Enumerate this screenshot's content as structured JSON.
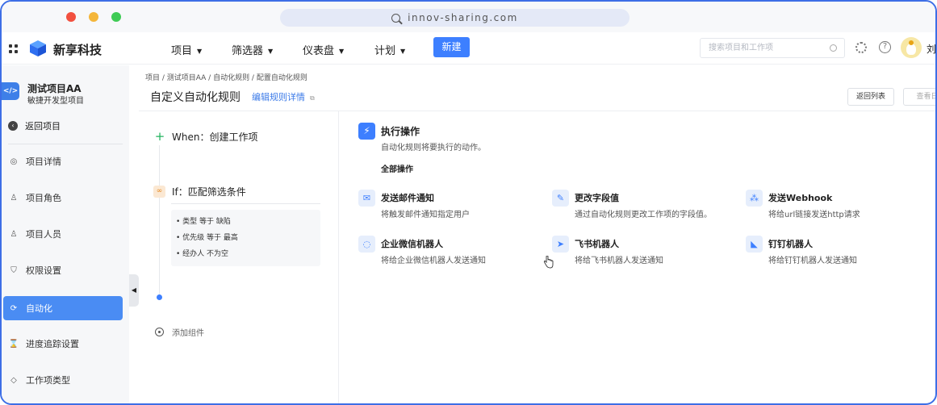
{
  "browser": {
    "url": "innov-sharing.com"
  },
  "topnav": {
    "brand": "新享科技",
    "items": [
      {
        "label": "项目"
      },
      {
        "label": "筛选器"
      },
      {
        "label": "仪表盘"
      },
      {
        "label": "计划"
      }
    ],
    "new_button": "新建",
    "search_placeholder": "搜索项目和工作项",
    "user_name": "刘"
  },
  "sidebar": {
    "project_icon": "</>",
    "project_name": "测试项目AA",
    "project_type": "敏捷开发型项目",
    "back_label": "返回项目",
    "items": [
      {
        "label": "项目详情",
        "icon": "gear-circle-icon"
      },
      {
        "label": "项目角色",
        "icon": "person-icon"
      },
      {
        "label": "项目人员",
        "icon": "people-icon"
      },
      {
        "label": "权限设置",
        "icon": "shield-icon"
      },
      {
        "label": "自动化",
        "icon": "automation-icon",
        "active": true
      },
      {
        "label": "进度追踪设置",
        "icon": "hourglass-icon"
      },
      {
        "label": "工作项类型",
        "icon": "tag-icon"
      }
    ]
  },
  "breadcrumb": "项目 / 测试项目AA / 自动化规则 / 配置自动化规则",
  "page": {
    "title": "自定义自动化规则",
    "edit_link": "编辑规则详情",
    "back_to_list": "返回列表",
    "view_logs": "查看日"
  },
  "flow": {
    "when_label": "When：创建工作项",
    "if_label": "If：匹配筛选条件",
    "conditions": [
      "• 类型   等于   缺陷",
      "• 优先级   等于   最高",
      "• 经办人   不为空"
    ],
    "add_component": "添加组件"
  },
  "actions_panel": {
    "title": "执行操作",
    "description": "自动化规则将要执行的动作。",
    "section_label": "全部操作",
    "actions": [
      {
        "title": "发送邮件通知",
        "desc": "将触发邮件通知指定用户",
        "icon": "mail-icon"
      },
      {
        "title": "更改字段值",
        "desc": "通过自动化规则更改工作项的字段值。",
        "icon": "edit-icon"
      },
      {
        "title": "发送Webhook",
        "desc": "将给url链接发送http请求",
        "icon": "webhook-icon"
      },
      {
        "title": "企业微信机器人",
        "desc": "将给企业微信机器人发送通知",
        "icon": "wecom-icon"
      },
      {
        "title": "飞书机器人",
        "desc": "将给飞书机器人发送通知",
        "icon": "feishu-icon"
      },
      {
        "title": "钉钉机器人",
        "desc": "将给钉钉机器人发送通知",
        "icon": "dingtalk-icon"
      }
    ]
  },
  "colors": {
    "primary": "#3d7fff",
    "sidebar_active": "#4a8cf3",
    "window_border": "#3d6ee6"
  }
}
